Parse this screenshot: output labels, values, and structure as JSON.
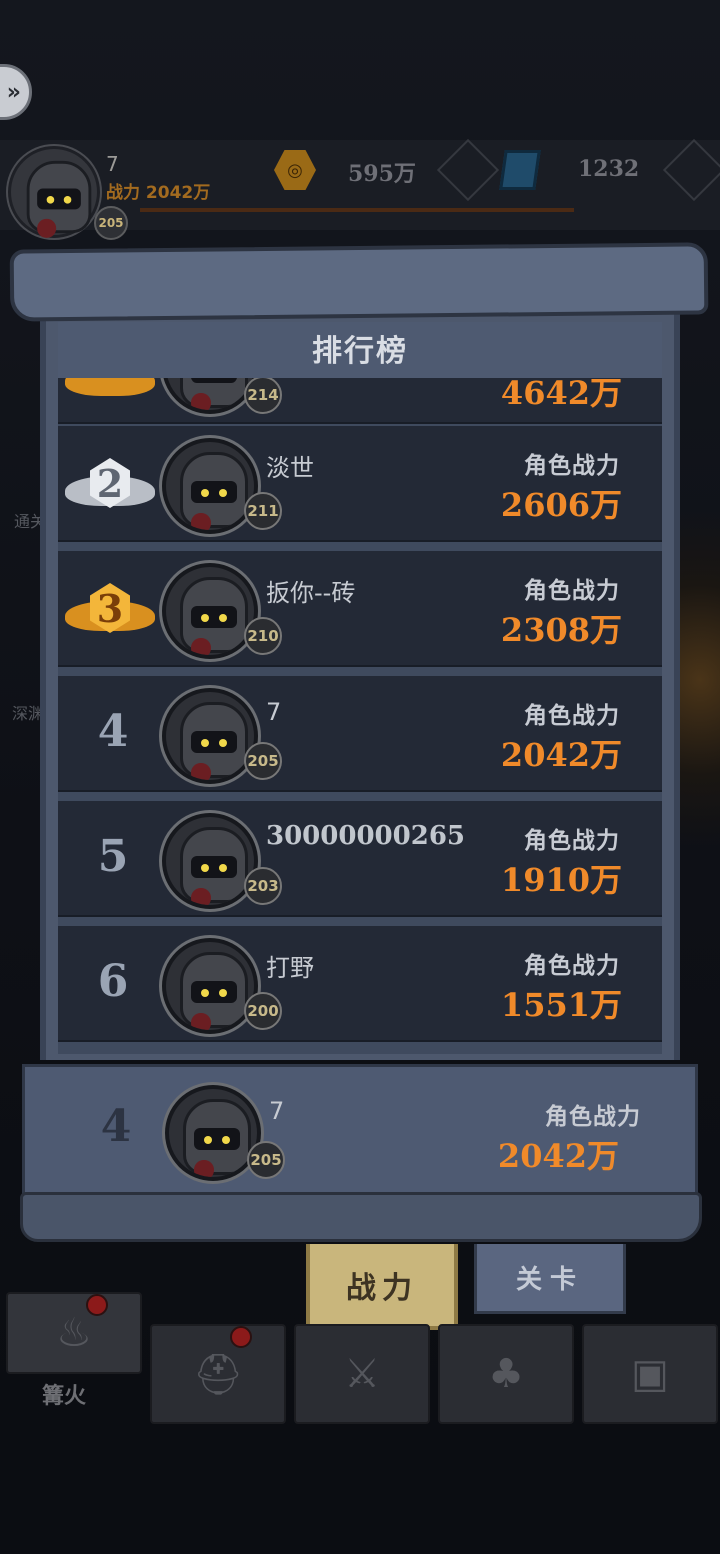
{
  "header": {
    "player_name": "7",
    "player_power": "战力 2042万",
    "player_level": "205",
    "gold": "595万",
    "gems": "1232"
  },
  "side_text": {
    "left1": "通关",
    "left2": "深渊"
  },
  "title": "排行榜",
  "power_label": "角色战力",
  "partial_row": {
    "level": "214",
    "power": "4642万"
  },
  "entries": [
    {
      "rank": "2",
      "name": "淡世",
      "level": "211",
      "power": "2606万"
    },
    {
      "rank": "3",
      "name": "扳你--砖",
      "level": "210",
      "power": "2308万"
    },
    {
      "rank": "4",
      "name": "7",
      "level": "205",
      "power": "2042万"
    },
    {
      "rank": "5",
      "name": "30000000265",
      "level": "203",
      "power": "1910万"
    },
    {
      "rank": "6",
      "name": "打野",
      "level": "200",
      "power": "1551万"
    }
  ],
  "my_entry": {
    "rank": "4",
    "name": "7",
    "level": "205",
    "power": "2042万"
  },
  "tabs": {
    "power": "战力",
    "level": "关卡"
  },
  "nav": {
    "campfire_label": "篝火"
  },
  "colors": {
    "power_orange": "#f08a2a",
    "panel": "#4d586d",
    "row": "#232936",
    "tab_active": "#c9b67c"
  }
}
